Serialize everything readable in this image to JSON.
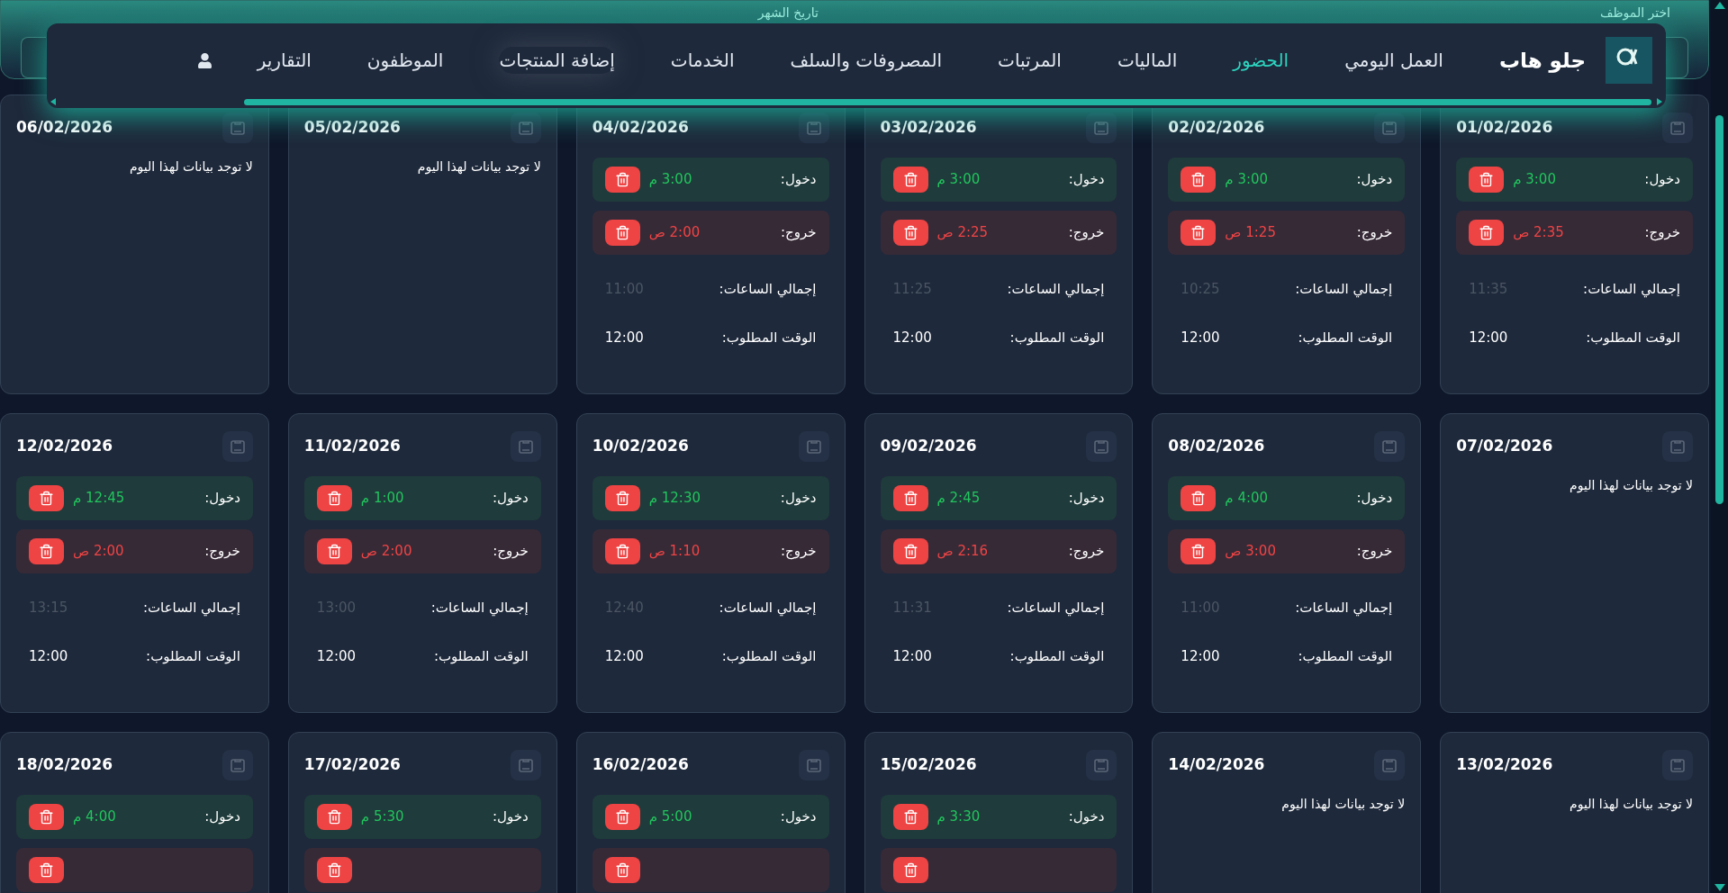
{
  "filters": [
    {
      "label": "اختر الموظف"
    },
    {
      "label": "تاريخ الشهر"
    }
  ],
  "nav": {
    "brand": "جلو هاب",
    "items": [
      {
        "label": "العمل اليومي",
        "selected": false
      },
      {
        "label": "الحضور",
        "selected": true
      },
      {
        "label": "الماليات",
        "selected": false
      },
      {
        "label": "المرتبات",
        "selected": false
      },
      {
        "label": "المصروفات والسلف",
        "selected": false
      },
      {
        "label": "الخدمات",
        "selected": false
      },
      {
        "label": "إضافة المنتجات",
        "selected": false,
        "hovered": true
      },
      {
        "label": "الموظفون",
        "selected": false
      },
      {
        "label": "التقارير",
        "selected": false
      }
    ]
  },
  "cards": [
    {
      "kind": "day",
      "date": "01/02/2026",
      "entry": {
        "label": "دخول:",
        "time": "3:00 م"
      },
      "exit": {
        "label": "خروج:",
        "time": "2:35 ص"
      },
      "total": {
        "label": "إجمالي الساعات:",
        "value": "11:35"
      },
      "required": {
        "label": "الوقت المطلوب:",
        "value": "12:00"
      }
    },
    {
      "kind": "day",
      "date": "02/02/2026",
      "entry": {
        "label": "دخول:",
        "time": "3:00 م"
      },
      "exit": {
        "label": "خروج:",
        "time": "1:25 ص"
      },
      "total": {
        "label": "إجمالي الساعات:",
        "value": "10:25"
      },
      "required": {
        "label": "الوقت المطلوب:",
        "value": "12:00"
      }
    },
    {
      "kind": "day",
      "date": "03/02/2026",
      "entry": {
        "label": "دخول:",
        "time": "3:00 م"
      },
      "exit": {
        "label": "خروج:",
        "time": "2:25 ص"
      },
      "total": {
        "label": "إجمالي الساعات:",
        "value": "11:25"
      },
      "required": {
        "label": "الوقت المطلوب:",
        "value": "12:00"
      }
    },
    {
      "kind": "day",
      "date": "04/02/2026",
      "entry": {
        "label": "دخول:",
        "time": "3:00 م"
      },
      "exit": {
        "label": "خروج:",
        "time": "2:00 ص"
      },
      "total": {
        "label": "إجمالي الساعات:",
        "value": "11:00"
      },
      "required": {
        "label": "الوقت المطلوب:",
        "value": "12:00"
      }
    },
    {
      "kind": "empty",
      "date": "05/02/2026",
      "message": "لا توجد بيانات لهذا اليوم"
    },
    {
      "kind": "empty",
      "date": "06/02/2026",
      "message": "لا توجد بيانات لهذا اليوم"
    },
    {
      "kind": "empty",
      "date": "07/02/2026",
      "message": "لا توجد بيانات لهذا اليوم"
    },
    {
      "kind": "day",
      "date": "08/02/2026",
      "entry": {
        "label": "دخول:",
        "time": "4:00 م"
      },
      "exit": {
        "label": "خروج:",
        "time": "3:00 ص"
      },
      "total": {
        "label": "إجمالي الساعات:",
        "value": "11:00"
      },
      "required": {
        "label": "الوقت المطلوب:",
        "value": "12:00"
      }
    },
    {
      "kind": "day",
      "date": "09/02/2026",
      "entry": {
        "label": "دخول:",
        "time": "2:45 م"
      },
      "exit": {
        "label": "خروج:",
        "time": "2:16 ص"
      },
      "total": {
        "label": "إجمالي الساعات:",
        "value": "11:31"
      },
      "required": {
        "label": "الوقت المطلوب:",
        "value": "12:00"
      }
    },
    {
      "kind": "day",
      "date": "10/02/2026",
      "entry": {
        "label": "دخول:",
        "time": "12:30 م"
      },
      "exit": {
        "label": "خروج:",
        "time": "1:10 ص"
      },
      "total": {
        "label": "إجمالي الساعات:",
        "value": "12:40"
      },
      "required": {
        "label": "الوقت المطلوب:",
        "value": "12:00"
      }
    },
    {
      "kind": "day",
      "date": "11/02/2026",
      "entry": {
        "label": "دخول:",
        "time": "1:00 م"
      },
      "exit": {
        "label": "خروج:",
        "time": "2:00 ص"
      },
      "total": {
        "label": "إجمالي الساعات:",
        "value": "13:00"
      },
      "required": {
        "label": "الوقت المطلوب:",
        "value": "12:00"
      }
    },
    {
      "kind": "day",
      "date": "12/02/2026",
      "entry": {
        "label": "دخول:",
        "time": "12:45 م"
      },
      "exit": {
        "label": "خروج:",
        "time": "2:00 ص"
      },
      "total": {
        "label": "إجمالي الساعات:",
        "value": "13:15"
      },
      "required": {
        "label": "الوقت المطلوب:",
        "value": "12:00"
      }
    },
    {
      "kind": "empty",
      "date": "13/02/2026",
      "message": "لا توجد بيانات لهذا اليوم"
    },
    {
      "kind": "empty",
      "date": "14/02/2026",
      "message": "لا توجد بيانات لهذا اليوم"
    },
    {
      "kind": "partial",
      "date": "15/02/2026",
      "entry": {
        "label": "دخول:",
        "time": "3:30 م"
      }
    },
    {
      "kind": "partial",
      "date": "16/02/2026",
      "entry": {
        "label": "دخول:",
        "time": "5:00 م"
      }
    },
    {
      "kind": "partial",
      "date": "17/02/2026",
      "entry": {
        "label": "دخول:",
        "time": "5:30 م"
      }
    },
    {
      "kind": "partial",
      "date": "18/02/2026",
      "entry": {
        "label": "دخول:",
        "time": "4:00 م"
      }
    }
  ]
}
